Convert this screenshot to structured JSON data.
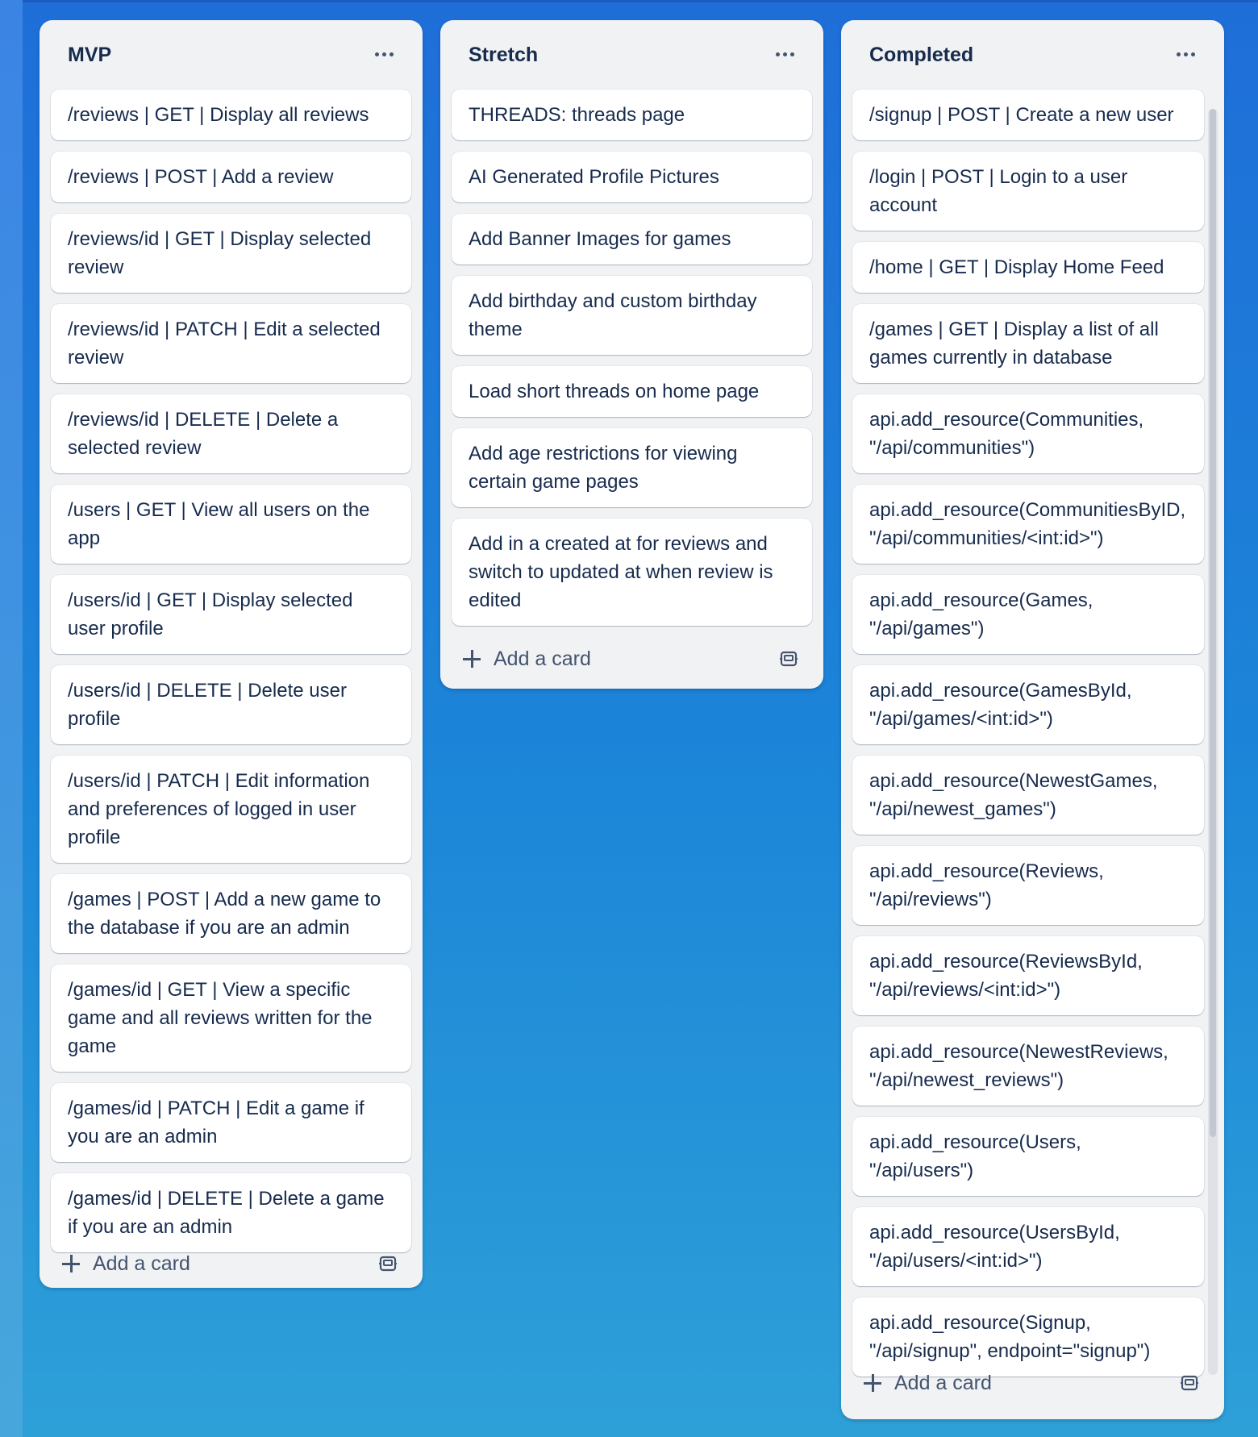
{
  "columns": [
    {
      "title": "MVP",
      "cards": [
        "/reviews | GET | Display all reviews",
        "/reviews | POST | Add a review",
        "/reviews/id | GET | Display selected review",
        "/reviews/id | PATCH | Edit a selected review",
        "/reviews/id | DELETE | Delete a selected review",
        "/users | GET | View all users on the app",
        "/users/id | GET | Display selected user profile",
        "/users/id | DELETE | Delete user profile",
        "/users/id | PATCH | Edit information and preferences of logged in user profile",
        "/games | POST | Add a new game to the database if you are an admin",
        "/games/id | GET | View a specific game and all reviews written for the game",
        "/games/id | PATCH | Edit a game if you are an admin",
        "/games/id | DELETE | Delete a game if you are an admin"
      ],
      "add_label": "Add a card"
    },
    {
      "title": "Stretch",
      "cards": [
        "THREADS: threads page",
        "AI Generated Profile Pictures",
        "Add Banner Images for games",
        "Add birthday and custom birthday theme",
        "Load short threads on home page",
        "Add age restrictions for viewing certain game pages",
        "Add in a created at for reviews and switch to updated at when review is edited"
      ],
      "add_label": "Add a card"
    },
    {
      "title": "Completed",
      "cards": [
        "/signup | POST | Create a new user",
        "/login | POST | Login to a user account",
        "/home | GET | Display Home Feed",
        "/games | GET | Display a list of all games currently in database",
        "api.add_resource(Communities, \"/api/communities\")",
        "api.add_resource(CommunitiesByID, \"/api/communities/<int:id>\")",
        "api.add_resource(Games, \"/api/games\")",
        "api.add_resource(GamesById, \"/api/games/<int:id>\")",
        "api.add_resource(NewestGames, \"/api/newest_games\")",
        "api.add_resource(Reviews, \"/api/reviews\")",
        "api.add_resource(ReviewsById, \"/api/reviews/<int:id>\")",
        "api.add_resource(NewestReviews, \"/api/newest_reviews\")",
        "api.add_resource(Users, \"/api/users\")",
        "api.add_resource(UsersById, \"/api/users/<int:id>\")",
        "api.add_resource(Signup, \"/api/signup\", endpoint=\"signup\")"
      ],
      "add_label": "Add a card"
    }
  ],
  "icons": {
    "menu": "more-horizontal-icon",
    "add": "plus-icon",
    "template": "card-template-icon"
  },
  "colors": {
    "board_top": "#1f6ed8",
    "board_bottom": "#2ea0d8",
    "list_bg": "#f1f2f4",
    "card_bg": "#ffffff",
    "text": "#172b4d",
    "muted": "#44546f"
  }
}
